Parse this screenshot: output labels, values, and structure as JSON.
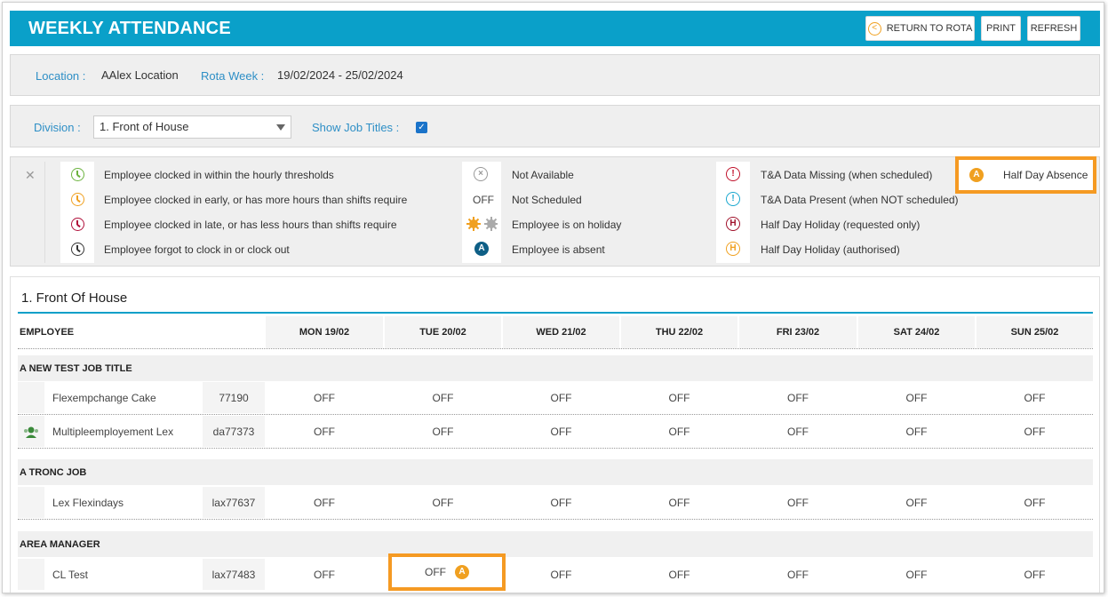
{
  "header": {
    "title": "WEEKLY ATTENDANCE",
    "return_label": "RETURN TO ROTA",
    "print_label": "PRINT",
    "refresh_label": "REFRESH",
    "color": "#0aa0c9"
  },
  "filters": {
    "location_label": "Location :",
    "location_value": "AAlex Location",
    "rota_week_label": "Rota Week :",
    "rota_week_value": "19/02/2024 - 25/02/2024",
    "division_label": "Division :",
    "division_value": "1. Front of House",
    "show_job_titles_label": "Show Job Titles :",
    "show_job_titles_checked": true
  },
  "legend": {
    "col1": [
      {
        "icon": "clock-green-icon",
        "text": "Employee clocked in within the hourly thresholds",
        "color": "#6cb33f"
      },
      {
        "icon": "clock-orange-icon",
        "text": "Employee clocked in early, or has more hours than shifts require",
        "color": "#f0a020"
      },
      {
        "icon": "clock-red-icon",
        "text": "Employee clocked in late, or has less hours than shifts require",
        "color": "#b0103a"
      },
      {
        "icon": "clock-black-icon",
        "text": "Employee forgot to clock in or clock out",
        "color": "#333333"
      }
    ],
    "col2": [
      {
        "icon": "not-available-icon",
        "symbol": "×",
        "text": "Not Available"
      },
      {
        "icon": "off-text",
        "symbol": "OFF",
        "text": "Not Scheduled"
      },
      {
        "icon": "holiday-sun-icon",
        "text": "Employee is on holiday"
      },
      {
        "icon": "absent-icon",
        "symbol": "A",
        "text": "Employee is absent"
      }
    ],
    "col3": [
      {
        "icon": "ta-missing-icon",
        "symbol": "!",
        "text": "T&A Data Missing (when scheduled)",
        "color": "#c0102a"
      },
      {
        "icon": "ta-present-icon",
        "symbol": "!",
        "text": "T&A Data Present (when NOT scheduled)",
        "color": "#19a7cf"
      },
      {
        "icon": "half-holiday-requested-icon",
        "symbol": "H",
        "text": "Half Day Holiday (requested only)",
        "color": "#a0102a"
      },
      {
        "icon": "half-holiday-authorised-icon",
        "symbol": "H",
        "text": "Half Day Holiday (authorised)",
        "color": "#f0a020"
      }
    ],
    "half_day_absence": {
      "symbol": "A",
      "text": "Half Day Absence",
      "color": "#f0a020"
    }
  },
  "section": {
    "title": "1. Front Of House",
    "employee_header": "EMPLOYEE",
    "days": [
      "MON 19/02",
      "TUE 20/02",
      "WED 21/02",
      "THU 22/02",
      "FRI 23/02",
      "SAT 24/02",
      "SUN 25/02"
    ],
    "groups": [
      {
        "title": "A NEW TEST JOB TITLE",
        "rows": [
          {
            "name": "Flexempchange Cake",
            "id": "77190",
            "icon": false,
            "cells": [
              "OFF",
              "OFF",
              "OFF",
              "OFF",
              "OFF",
              "OFF",
              "OFF"
            ]
          },
          {
            "name": "Multipleemployement Lex",
            "id": "da77373",
            "icon": true,
            "cells": [
              "OFF",
              "OFF",
              "OFF",
              "OFF",
              "OFF",
              "OFF",
              "OFF"
            ]
          }
        ]
      },
      {
        "title": "A TRONC JOB",
        "rows": [
          {
            "name": "Lex Flexindays",
            "id": "lax77637",
            "icon": false,
            "cells": [
              "OFF",
              "OFF",
              "OFF",
              "OFF",
              "OFF",
              "OFF",
              "OFF"
            ]
          }
        ]
      },
      {
        "title": "AREA MANAGER",
        "rows": [
          {
            "name": "CL Test",
            "id": "lax77483",
            "icon": false,
            "cells": [
              "OFF",
              "OFF",
              "OFF",
              "OFF",
              "OFF",
              "OFF",
              "OFF"
            ],
            "half_day_absence_day": "TUE 20/02",
            "half_day_symbol": "A"
          }
        ]
      }
    ]
  },
  "highlight_color": "#f59a23"
}
